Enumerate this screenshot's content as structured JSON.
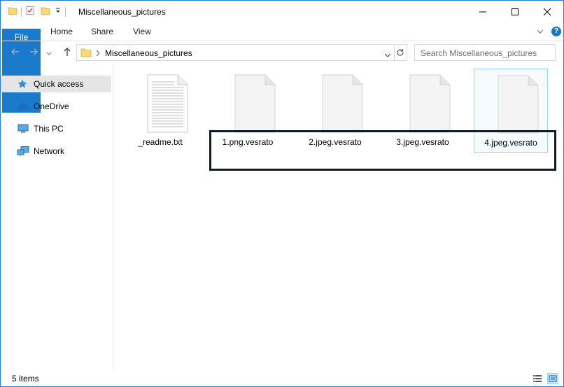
{
  "window": {
    "title": "Miscellaneous_pictures",
    "controls": {
      "minimize": "—",
      "maximize": "☐",
      "close": "✕"
    }
  },
  "ribbon": {
    "tabs": [
      {
        "label": "File"
      },
      {
        "label": "Home"
      },
      {
        "label": "Share"
      },
      {
        "label": "View"
      }
    ],
    "help_label": "?"
  },
  "address": {
    "path": "Miscellaneous_pictures",
    "search_placeholder": "Search Miscellaneous_pictures"
  },
  "nav": {
    "items": [
      {
        "label": "Quick access",
        "icon": "star-icon"
      },
      {
        "label": "OneDrive",
        "icon": "cloud-icon"
      },
      {
        "label": "This PC",
        "icon": "computer-icon"
      },
      {
        "label": "Network",
        "icon": "network-icon"
      }
    ]
  },
  "files": [
    {
      "name": "_readme.txt",
      "type": "text"
    },
    {
      "name": "1.png.vesrato",
      "type": "blank"
    },
    {
      "name": "2.jpeg.vesrato",
      "type": "blank"
    },
    {
      "name": "3.jpeg.vesrato",
      "type": "blank"
    },
    {
      "name": "4.jpeg.vesrato",
      "type": "blank"
    }
  ],
  "status": {
    "item_count": "5 items"
  },
  "colors": {
    "accent": "#1979ca",
    "highlight_box": "#0d1b2a",
    "folder": "#f8d775"
  }
}
